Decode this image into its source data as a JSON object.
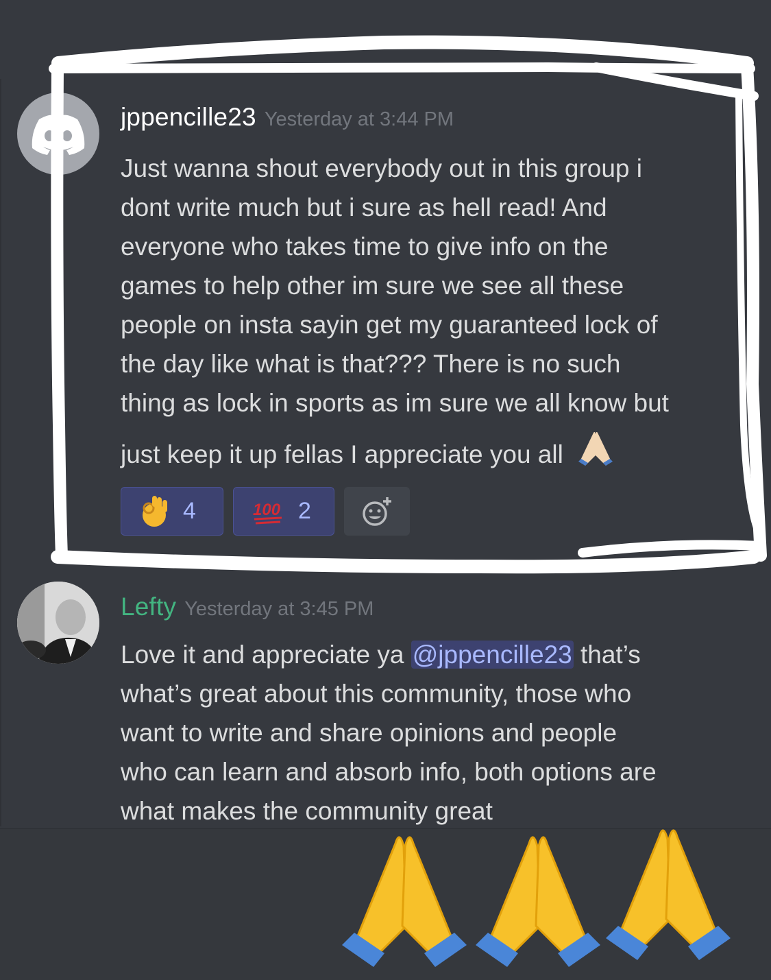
{
  "messages": [
    {
      "username": "jppencille23",
      "timestamp": "Yesterday at 3:44 PM",
      "avatar_icon": "discord-logo-icon",
      "text": "Just wanna shout everybody out in this group i\ndont write much but i sure as hell read! And\neveryone who takes time to give info on the\ngames to help other im sure we see all these\npeople on insta sayin get my guaranteed lock of\nthe day like what is that??? There is no such\nthing as lock in sports as im sure we all know but",
      "last_line": "just keep it up fellas I appreciate you all",
      "last_line_emoji": "folded-hands-icon",
      "reactions": [
        {
          "icon": "ok-hand-icon",
          "count": "4"
        },
        {
          "icon": "hundred-points-icon",
          "count": "2"
        }
      ],
      "add_reaction_icon": "add-reaction-icon"
    },
    {
      "username": "Lefty",
      "username_color": "#43b581",
      "timestamp": "Yesterday at 3:45 PM",
      "text_before_mention": "Love it and appreciate ya ",
      "mention": "@jppencille23",
      "text_after_mention": " that’s",
      "text_rest": "what’s great about this community, those who\nwant to write and share opinions and people\nwho can learn and absorb info, both options are\nwhat makes the community great"
    }
  ],
  "overlay": {
    "highlight_color": "#ffffff",
    "emoji": [
      "folded-hands-icon",
      "folded-hands-icon",
      "folded-hands-icon"
    ]
  },
  "colors": {
    "background": "#36393f",
    "mention_bg": "#3d4270",
    "mention_text": "#a9b9ff"
  }
}
